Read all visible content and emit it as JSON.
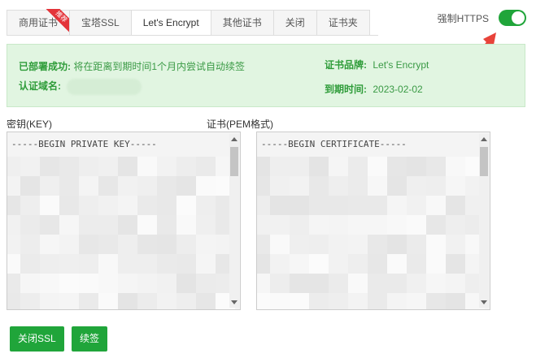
{
  "tabs": [
    {
      "label": "商用证书",
      "badge": "推荐"
    },
    {
      "label": "宝塔SSL"
    },
    {
      "label": "Let's Encrypt",
      "active": true
    },
    {
      "label": "其他证书"
    },
    {
      "label": "关闭"
    },
    {
      "label": "证书夹"
    }
  ],
  "force_https": {
    "label": "强制HTTPS",
    "enabled": true
  },
  "status": {
    "deploy_key": "已部署成功:",
    "deploy_value": "将在距离到期时间1个月内尝试自动续签",
    "domain_key": "认证域名:",
    "brand_key": "证书品牌:",
    "brand_value": "Let's Encrypt",
    "expiry_key": "到期时间:",
    "expiry_value": "2023-02-02"
  },
  "key_field": {
    "label": "密钥(KEY)",
    "header": "-----BEGIN PRIVATE KEY-----"
  },
  "cert_field": {
    "label": "证书(PEM格式)",
    "header": "-----BEGIN CERTIFICATE-----"
  },
  "buttons": {
    "close_ssl": "关闭SSL",
    "renew": "续签"
  },
  "colors": {
    "accent": "#20a53a",
    "info_bg": "#e1f5e1",
    "arrow": "#e8433a",
    "badge": "#e3343a"
  }
}
